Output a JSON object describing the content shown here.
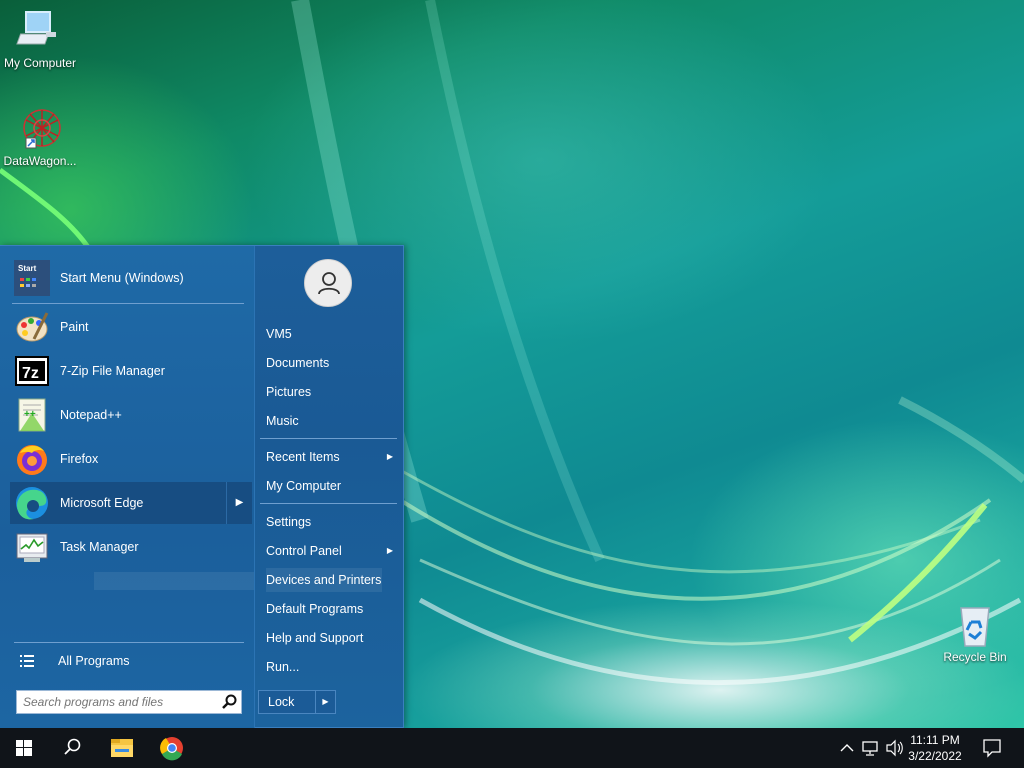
{
  "desktop": {
    "icons": [
      {
        "label": "My Computer",
        "icon": "monitor-icon"
      },
      {
        "label": "DataWagon...",
        "icon": "network-graph-icon"
      },
      {
        "label": "Recycle Bin",
        "icon": "recycle-bin-icon"
      }
    ]
  },
  "start_menu": {
    "pinned": [
      {
        "label": "Start Menu (Windows)",
        "icon": "start-menu-app-icon"
      },
      {
        "label": "Paint",
        "icon": "paint-palette-icon"
      },
      {
        "label": "7-Zip File Manager",
        "icon": "seven-zip-icon"
      },
      {
        "label": "Notepad++",
        "icon": "notepadpp-icon"
      },
      {
        "label": "Firefox",
        "icon": "firefox-icon"
      },
      {
        "label": "Microsoft Edge",
        "icon": "edge-icon",
        "has_submenu": true
      },
      {
        "label": "Task Manager",
        "icon": "task-manager-icon"
      }
    ],
    "start_icon_text": "Start",
    "all_programs": "All Programs",
    "search_placeholder": "Search programs and files",
    "right_items": [
      {
        "label": "VM5"
      },
      {
        "label": "Documents"
      },
      {
        "label": "Pictures"
      },
      {
        "label": "Music"
      },
      {
        "label": "Recent Items",
        "has_submenu": true
      },
      {
        "label": "My Computer"
      },
      {
        "label": "Settings"
      },
      {
        "label": "Control Panel",
        "has_submenu": true
      },
      {
        "label": "Devices and Printers"
      },
      {
        "label": "Default Programs"
      },
      {
        "label": "Help and Support"
      },
      {
        "label": "Run..."
      }
    ],
    "lock_label": "Lock",
    "seven_zip_text": "7z"
  },
  "taskbar": {
    "time": "11:11 PM",
    "date": "3/22/2022",
    "pinned": [
      "windows-start-icon",
      "search-icon",
      "file-explorer-icon",
      "chrome-icon"
    ],
    "colors": {
      "taskbar": "#101419",
      "start_menu": "#1b5f9c"
    }
  }
}
